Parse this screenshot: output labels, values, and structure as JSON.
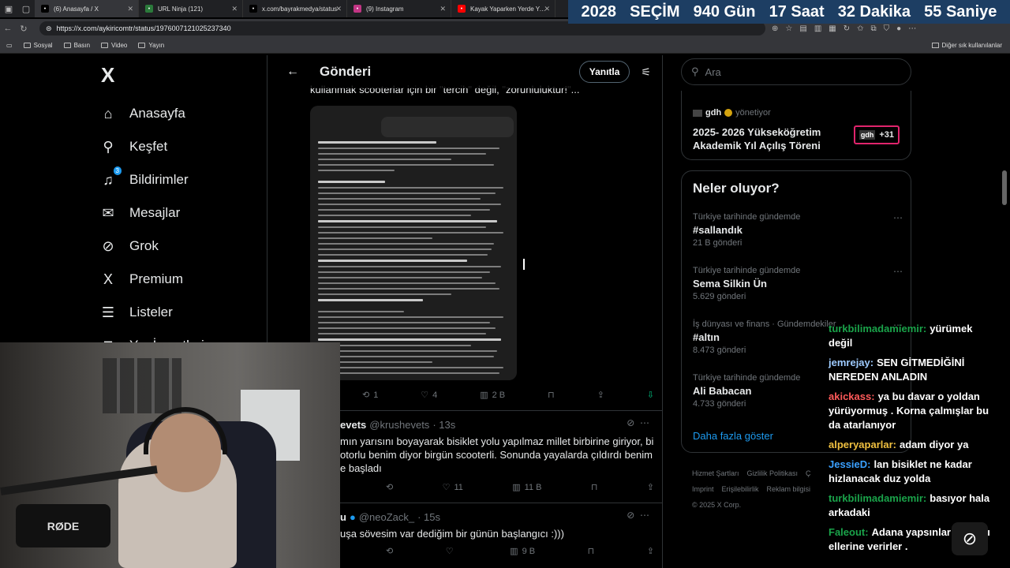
{
  "browser": {
    "tabs": [
      {
        "title": "(6) Anasayfa / X",
        "icon": "x-icon",
        "color": "#000000",
        "active": true
      },
      {
        "title": "URL Ninja (121)",
        "icon": "url-ninja-icon",
        "color": "#2b7a3b"
      },
      {
        "title": "x.com/bayrakmedya/status",
        "icon": "x-icon",
        "color": "#000000"
      },
      {
        "title": "(9) Instagram",
        "icon": "instagram-icon",
        "color": "#c13584"
      },
      {
        "title": "Kayak Yaparken Yerde Yata",
        "icon": "youtube-icon",
        "color": "#ff0000"
      }
    ],
    "url": "https://x.com/aykiricomtr/status/1976007121025237340",
    "bookmarks": [
      "Sosyal",
      "Basın",
      "Video",
      "Yayın"
    ],
    "bookmarks_right": "Diğer sık kullanılanlar"
  },
  "countdown": {
    "year": "2028",
    "label": "SEÇİM",
    "days": "940 Gün",
    "hours": "17 Saat",
    "minutes": "32 Dakika",
    "seconds": "55 Saniye"
  },
  "nav": {
    "logo": "X",
    "items": [
      {
        "label": "Anasayfa",
        "icon": "home-icon"
      },
      {
        "label": "Keşfet",
        "icon": "search-icon"
      },
      {
        "label": "Bildirimler",
        "icon": "bell-icon",
        "badge": "3"
      },
      {
        "label": "Mesajlar",
        "icon": "mail-icon"
      },
      {
        "label": "Grok",
        "icon": "grok-icon"
      },
      {
        "label": "Premium",
        "icon": "x-premium-icon"
      },
      {
        "label": "Listeler",
        "icon": "list-icon"
      },
      {
        "label": "Yer İşaretleri",
        "icon": "bookmark-icon"
      }
    ]
  },
  "main": {
    "title": "Gönderi",
    "reply_button": "Yanıtla",
    "quote_text": "kullanmak scooterlar için bir \"tercih\" değil, \"zorunluluktur!\"...",
    "post_actions": {
      "reposts": "1",
      "likes": "4",
      "views": "2 B"
    },
    "tweets": [
      {
        "name": "evets",
        "handle": "@krushevets",
        "time": "· 13s",
        "text": "mın yarısını boyayarak bisiklet yolu yapılmaz millet birbirine giriyor, bi otorlu benim diyor birgün scooterli. Sonunda yayalarda çıldırdı benim e başladı",
        "likes": "11",
        "views": "11 B"
      },
      {
        "name": "u",
        "handle": "@neoZack_",
        "time": "· 15s",
        "text": "uşa sövesim var dediğim bir günün başlangıcı :)))",
        "likes": "",
        "views": "9 B"
      }
    ]
  },
  "right": {
    "search_placeholder": "Ara",
    "event": {
      "org": "gdh",
      "role": "yönetiyor",
      "title": "2025- 2026 Yükseköğretim Akademik Yıl Açılış Töreni",
      "badge_logo": "gdh",
      "badge_count": "+31"
    },
    "trends_title": "Neler oluyor?",
    "trends": [
      {
        "context": "Türkiye tarihinde gündemde",
        "topic": "#sallandık",
        "count": "21 B gönderi"
      },
      {
        "context": "Türkiye tarihinde gündemde",
        "topic": "Sema Silkin Ün",
        "count": "5.629 gönderi"
      },
      {
        "context": "İş dünyası ve finans · Gündemdekiler",
        "topic": "#altın",
        "count": "8.473 gönderi"
      },
      {
        "context": "Türkiye tarihinde gündemde",
        "topic": "Ali Babacan",
        "count": "4.733 gönderi"
      }
    ],
    "show_more": "Daha fazla göster",
    "footer": [
      "Hizmet Şartları",
      "Gizlilik Politikası",
      "Ç",
      "Imprint",
      "Erişilebilirlik",
      "Reklam bilgisi",
      "© 2025 X Corp."
    ]
  },
  "chat": [
    {
      "user": "turkbilimadamiemir:",
      "text": "yürümek değil",
      "color": "#1aa34a"
    },
    {
      "user": "jemrejay:",
      "text": "SEN GİTMEDİĞİNİ NEREDEN ANLADIN",
      "color": "#9ecbff"
    },
    {
      "user": "akickass:",
      "text": "ya bu davar o yoldan yürüyormuş . Korna çalmışlar bu da atarlanıyor",
      "color": "#ff5a5a"
    },
    {
      "user": "alperyaparlar:",
      "text": "adam diyor ya",
      "color": "#f0c040"
    },
    {
      "user": "JessieD:",
      "text": "lan bisiklet ne kadar hizlanacak duz yolda",
      "color": "#3aa0ff"
    },
    {
      "user": "turkbilimadamiemir:",
      "text": "basıyor hala arkadaki",
      "color": "#1aa34a"
    },
    {
      "user": "Faleout:",
      "text": "Adana yapsınlar kornayı ellerine verirler .",
      "color": "#1aa34a"
    }
  ],
  "webcam": {
    "mic_brand": "RØDE"
  }
}
